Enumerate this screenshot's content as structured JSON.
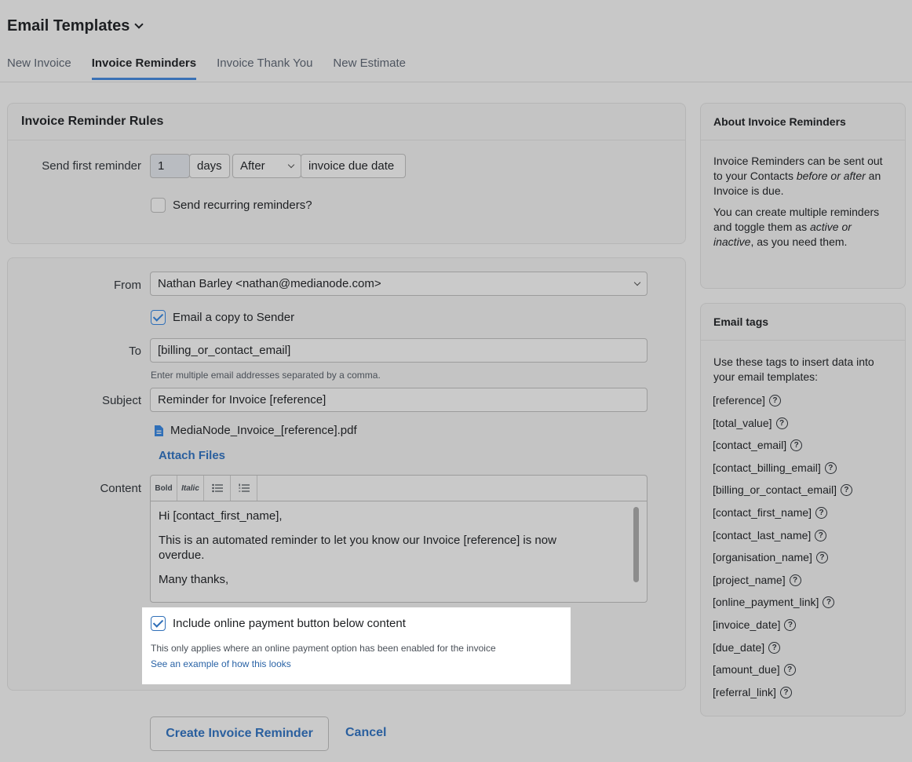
{
  "header": {
    "title": "Email Templates"
  },
  "tabs": [
    {
      "label": "New Invoice",
      "active": false
    },
    {
      "label": "Invoice Reminders",
      "active": true
    },
    {
      "label": "Invoice Thank You",
      "active": false
    },
    {
      "label": "New Estimate",
      "active": false
    }
  ],
  "rules": {
    "title": "Invoice Reminder Rules",
    "send_first_label": "Send first reminder",
    "days_value": "1",
    "days_unit": "days",
    "timing": "After",
    "reference_point": "invoice due date",
    "recurring_label": "Send recurring reminders?",
    "recurring_checked": false
  },
  "form": {
    "from_label": "From",
    "from_value": "Nathan Barley <nathan@medianode.com>",
    "copy_sender_label": "Email a copy to Sender",
    "copy_sender_checked": true,
    "to_label": "To",
    "to_value": "[billing_or_contact_email]",
    "to_hint": "Enter multiple email addresses separated by a comma.",
    "subject_label": "Subject",
    "subject_value": "Reminder for Invoice [reference]",
    "attachment_name": "MediaNode_Invoice_[reference].pdf",
    "attach_files_label": "Attach Files",
    "content_label": "Content",
    "toolbar": {
      "bold": "Bold",
      "italic": "Italic"
    },
    "content_lines": [
      "Hi [contact_first_name],",
      "This is an automated reminder to let you know our Invoice [reference] is now overdue.",
      "Many thanks,"
    ],
    "payment_button_label": "Include online payment button below content",
    "payment_button_checked": true,
    "payment_note": "This only applies where an online payment option has been enabled for the invoice",
    "payment_example_link": "See an example of how this looks"
  },
  "actions": {
    "create_label": "Create Invoice Reminder",
    "cancel_label": "Cancel"
  },
  "about": {
    "title": "About Invoice Reminders",
    "p1_a": "Invoice Reminders can be sent out to your Contacts ",
    "p1_em": "before or after",
    "p1_b": " an Invoice is due.",
    "p2_a": "You can create multiple reminders and toggle them as ",
    "p2_em": "active or inactive",
    "p2_b": ", as you need them."
  },
  "email_tags": {
    "title": "Email tags",
    "intro": "Use these tags to insert data into your email templates:",
    "tags": [
      "[reference]",
      "[total_value]",
      "[contact_email]",
      "[contact_billing_email]",
      "[billing_or_contact_email]",
      "[contact_first_name]",
      "[contact_last_name]",
      "[organisation_name]",
      "[project_name]",
      "[online_payment_link]",
      "[invoice_date]",
      "[due_date]",
      "[amount_due]",
      "[referral_link]"
    ]
  }
}
